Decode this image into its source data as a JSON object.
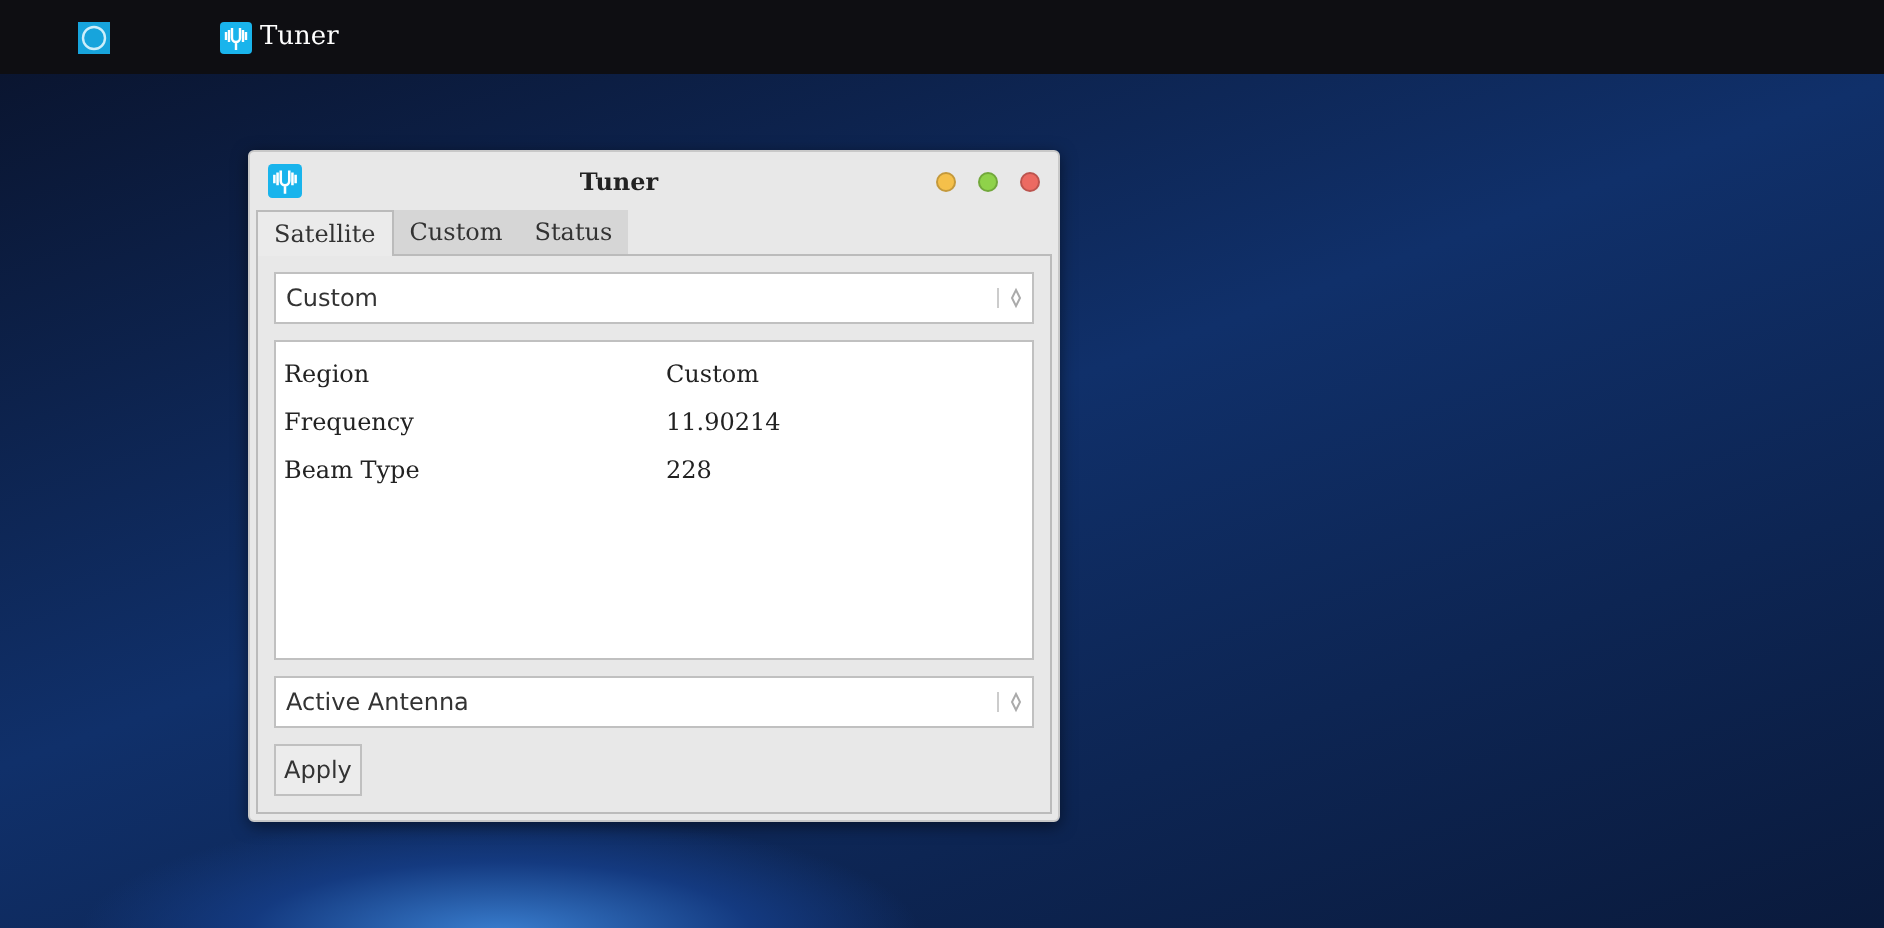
{
  "taskbar": {
    "items": [
      {
        "kind": "launcher"
      },
      {
        "kind": "app",
        "label": "Tuner"
      }
    ]
  },
  "window": {
    "title": "Tuner",
    "tabs": [
      {
        "label": "Satellite",
        "selected": true
      },
      {
        "label": "Custom",
        "selected": false
      },
      {
        "label": "Status",
        "selected": false
      }
    ],
    "preset_select": {
      "value": "Custom"
    },
    "properties": [
      {
        "name": "Region",
        "value": "Custom"
      },
      {
        "name": "Frequency",
        "value": "11.90214"
      },
      {
        "name": "Beam Type",
        "value": "228"
      }
    ],
    "antenna_select": {
      "value": "Active Antenna"
    },
    "apply_button": "Apply"
  }
}
